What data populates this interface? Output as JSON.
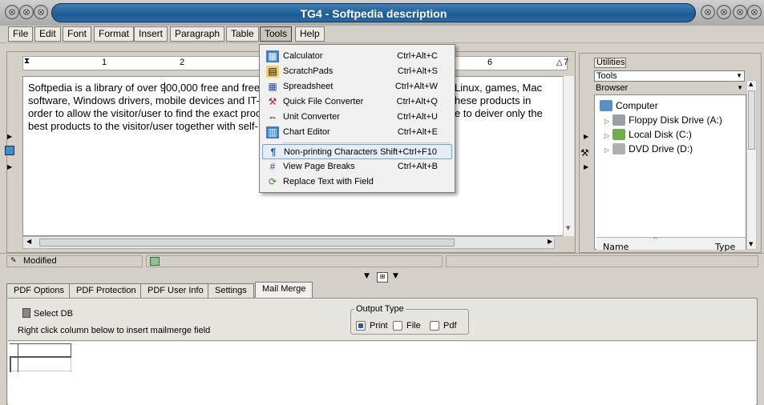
{
  "window": {
    "title": "TG4 - Softpedia description"
  },
  "menubar": {
    "items": [
      {
        "label": "File"
      },
      {
        "label": "Edit"
      },
      {
        "label": "Font"
      },
      {
        "label": "Format"
      },
      {
        "label": "Insert"
      },
      {
        "label": "Paragraph"
      },
      {
        "label": "Table"
      },
      {
        "label": "Tools"
      },
      {
        "label": "Help"
      }
    ],
    "active": "Tools"
  },
  "ruler": {
    "marks": [
      "1",
      "2",
      "6",
      "7"
    ]
  },
  "editor": {
    "lines": [
      "Softpedia is a library of over 900,000 free and free-",
      "software, Windows drivers, mobile devices and IT-r",
      "order to allow the visitor/user to find the exact proc",
      "best products to the visitor/user together with self-"
    ],
    "lines_right": [
      "Linux, games, Mac",
      "hese products in",
      "e to deiver only the",
      ""
    ]
  },
  "tools_menu": {
    "items": [
      {
        "label": "Calculator",
        "shortcut": "Ctrl+Alt+C",
        "icon": "calculator-icon"
      },
      {
        "label": "ScratchPads",
        "shortcut": "Ctrl+Alt+S",
        "icon": "scratchpad-icon"
      },
      {
        "label": "Spreadsheet",
        "shortcut": "Ctrl+Alt+W",
        "icon": "spreadsheet-icon"
      },
      {
        "label": "Quick File Converter",
        "shortcut": "Ctrl+Alt+Q",
        "icon": "converter-icon"
      },
      {
        "label": "Unit Converter",
        "shortcut": "Ctrl+Alt+U",
        "icon": "unit-converter-icon"
      },
      {
        "label": "Chart Editor",
        "shortcut": "Ctrl+Alt+E",
        "icon": "chart-icon"
      },
      {
        "label": "Non-printing Characters",
        "shortcut": "Shift+Ctrl+F10",
        "icon": "pilcrow-icon"
      },
      {
        "label": "View Page Breaks",
        "shortcut": "Ctrl+Alt+B",
        "icon": "page-break-icon"
      },
      {
        "label": "Replace Text with Field",
        "shortcut": "",
        "icon": "replace-field-icon"
      }
    ]
  },
  "utilities": {
    "tab_label": "Utilities",
    "combo1": "Tools",
    "combo2": "Browser",
    "tree": [
      {
        "label": "Computer",
        "level": 0
      },
      {
        "label": "Floppy Disk Drive (A:)",
        "level": 1
      },
      {
        "label": "Local Disk (C:)",
        "level": 1
      },
      {
        "label": "DVD Drive (D:)",
        "level": 1
      }
    ],
    "columns": [
      "Name",
      "Type"
    ]
  },
  "status": {
    "text": "Modified"
  },
  "lower_tabs": [
    {
      "label": "PDF Options"
    },
    {
      "label": "PDF Protection"
    },
    {
      "label": "PDF User Info"
    },
    {
      "label": "Settings"
    },
    {
      "label": "Mail Merge"
    }
  ],
  "mailmerge": {
    "select_db": "Select DB",
    "hint": "Right click column below to insert mailmerge field",
    "output_type_label": "Output Type",
    "options": [
      {
        "label": "Print",
        "checked": true
      },
      {
        "label": "File",
        "checked": false
      },
      {
        "label": "Pdf",
        "checked": false
      }
    ]
  },
  "colors": {
    "title_blue": "#1d5a94",
    "highlight": "#e4ecf6"
  }
}
